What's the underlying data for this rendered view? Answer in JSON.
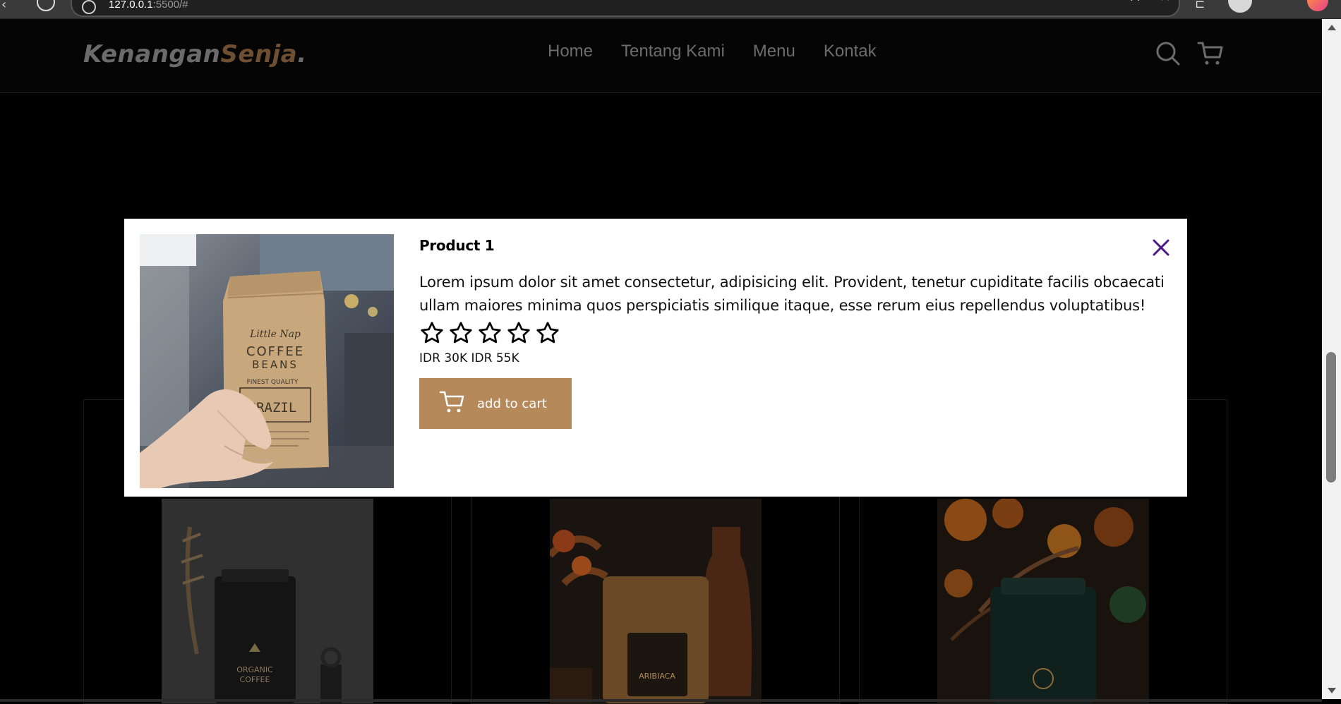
{
  "browser": {
    "url_host": "127.0.0.1",
    "url_rest": ":5500/#"
  },
  "navbar": {
    "logo": {
      "part1": "Kenangan",
      "part2": "Senja",
      "part3": "."
    },
    "links": [
      "Home",
      "Tentang Kami",
      "Menu",
      "Kontak"
    ],
    "icons": [
      "search-icon",
      "cart-icon"
    ]
  },
  "modal": {
    "title": "Product 1",
    "description": "Lorem ipsum dolor sit amet consectetur, adipisicing elit. Provident, tenetur cupiditate facilis obcaecati ullam maiores minima quos perspiciatis similique itaque, esse rerum eius repellendus voluptatibus!",
    "rating": {
      "filled": 0,
      "max": 5
    },
    "price": "IDR 30K IDR 55K",
    "add_to_cart_label": "add to cart",
    "image_text": {
      "brand": "Little Nap",
      "line1": "COFFEE",
      "line2": "BEANS",
      "tagline": "FINEST QUALITY",
      "origin": "BRAZIL"
    }
  },
  "background_cards": {
    "card1_pack_text": {
      "line1": "ORGANIC",
      "line2": "COFFEE"
    },
    "card2_pack_text": {
      "line1": "ARIBIACA"
    }
  },
  "colors": {
    "accent": "#b6895b",
    "logo_accent": "#6e4f32",
    "close_icon": "#4b1a86",
    "nav_text": "#6c6c6c"
  }
}
